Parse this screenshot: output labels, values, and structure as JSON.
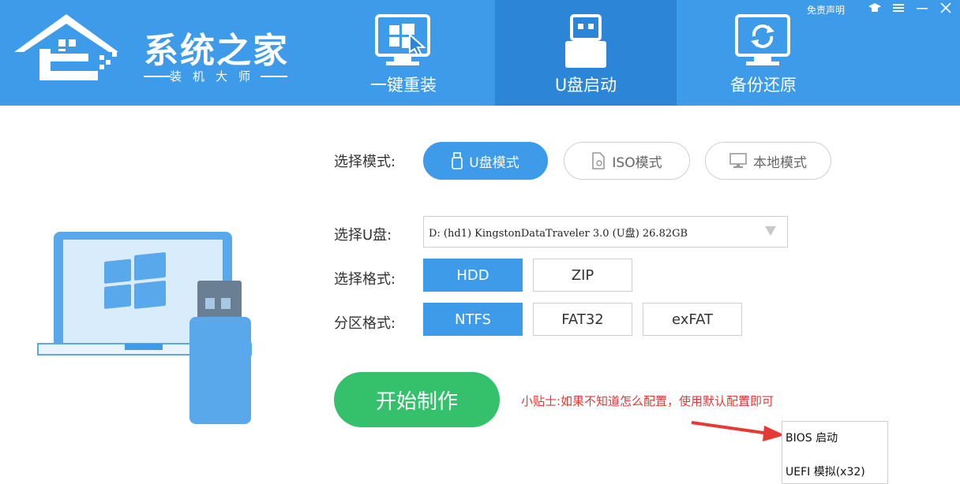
{
  "app": {
    "logo_title": "系统之家",
    "logo_subtitle": "装机大师"
  },
  "nav": {
    "tabs": [
      {
        "label": "一键重装",
        "icon": "monitor-windows-icon",
        "active": false
      },
      {
        "label": "U盘启动",
        "icon": "usb-drive-icon",
        "active": true
      },
      {
        "label": "备份还原",
        "icon": "backup-restore-icon",
        "active": false
      }
    ]
  },
  "window": {
    "disclaimer": "免责声明",
    "controls": [
      "hat-icon",
      "menu-icon",
      "minimize-icon",
      "close-icon"
    ]
  },
  "mode": {
    "label": "选择模式:",
    "options": [
      {
        "label": "U盘模式",
        "icon": "usb-stick-icon",
        "active": true
      },
      {
        "label": "ISO模式",
        "icon": "iso-file-icon",
        "active": false
      },
      {
        "label": "本地模式",
        "icon": "desktop-icon",
        "active": false
      }
    ]
  },
  "usb": {
    "label": "选择U盘:",
    "value": "D: (hd1) KingstonDataTraveler 3.0 (U盘) 26.82GB"
  },
  "format": {
    "label": "选择格式:",
    "options": [
      {
        "label": "HDD",
        "active": true
      },
      {
        "label": "ZIP",
        "active": false
      }
    ]
  },
  "partition": {
    "label": "分区格式:",
    "options": [
      {
        "label": "NTFS",
        "active": true
      },
      {
        "label": "FAT32",
        "active": false
      },
      {
        "label": "exFAT",
        "active": false
      }
    ]
  },
  "actions": {
    "start_label": "开始制作",
    "tip": "小贴士:如果不知道怎么配置，使用默认配置即可"
  },
  "boot_menu": {
    "items": [
      "BIOS 启动",
      "UEFI 模拟(x32)"
    ]
  },
  "colors": {
    "primary": "#3d9be9",
    "primary_dark": "#2c85d6",
    "start": "#35c06b",
    "tip": "#e53935"
  }
}
